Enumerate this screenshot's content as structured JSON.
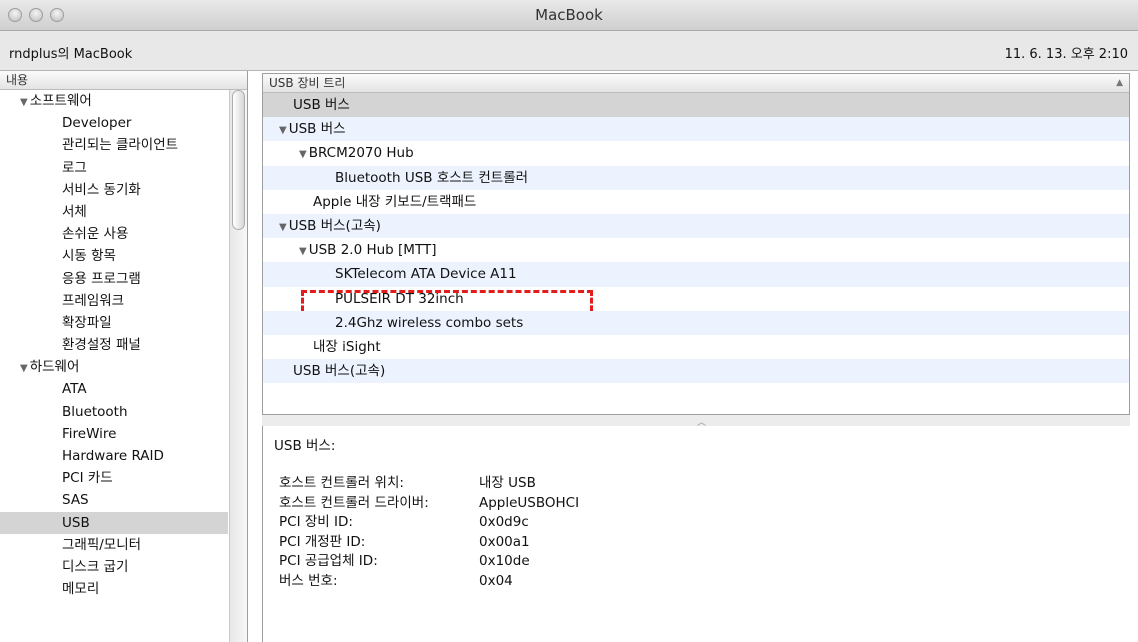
{
  "window": {
    "title": "MacBook"
  },
  "subheader": {
    "machine_name": "rndplus의 MacBook",
    "timestamp": "11. 6. 13. 오후 2:10"
  },
  "sidebar": {
    "header": "내용",
    "items": [
      {
        "label": "소프트웨어",
        "type": "category"
      },
      {
        "label": "Developer",
        "type": "sub"
      },
      {
        "label": "관리되는 클라이언트",
        "type": "sub"
      },
      {
        "label": "로그",
        "type": "sub"
      },
      {
        "label": "서비스 동기화",
        "type": "sub"
      },
      {
        "label": "서체",
        "type": "sub"
      },
      {
        "label": "손쉬운 사용",
        "type": "sub"
      },
      {
        "label": "시동 항목",
        "type": "sub"
      },
      {
        "label": "응용 프로그램",
        "type": "sub"
      },
      {
        "label": "프레임워크",
        "type": "sub"
      },
      {
        "label": "확장파일",
        "type": "sub"
      },
      {
        "label": "환경설정 패널",
        "type": "sub"
      },
      {
        "label": "하드웨어",
        "type": "category"
      },
      {
        "label": "ATA",
        "type": "sub"
      },
      {
        "label": "Bluetooth",
        "type": "sub"
      },
      {
        "label": "FireWire",
        "type": "sub"
      },
      {
        "label": "Hardware RAID",
        "type": "sub"
      },
      {
        "label": "PCI 카드",
        "type": "sub"
      },
      {
        "label": "SAS",
        "type": "sub"
      },
      {
        "label": "USB",
        "type": "sub",
        "selected": true
      },
      {
        "label": "그래픽/모니터",
        "type": "sub"
      },
      {
        "label": "디스크 굽기",
        "type": "sub"
      },
      {
        "label": "메모리",
        "type": "sub"
      }
    ]
  },
  "tree": {
    "header": "USB 장비 트리",
    "rows": [
      {
        "label": "USB 버스",
        "level": 0,
        "expanded": false,
        "selected": true
      },
      {
        "label": "USB 버스",
        "level": 0,
        "expanded": true
      },
      {
        "label": "BRCM2070 Hub",
        "level": 1,
        "expanded": true
      },
      {
        "label": "Bluetooth USB 호스트 컨트롤러",
        "level": 2
      },
      {
        "label": "Apple 내장 키보드/트랙패드",
        "level": 1
      },
      {
        "label": "USB 버스(고속)",
        "level": 0,
        "expanded": true
      },
      {
        "label": "USB 2.0 Hub [MTT]",
        "level": 1,
        "expanded": true
      },
      {
        "label": "SKTelecom ATA Device A11",
        "level": 2
      },
      {
        "label": "PULSEIR DT 32inch",
        "level": 2,
        "highlighted": true
      },
      {
        "label": "2.4Ghz wireless combo sets",
        "level": 2
      },
      {
        "label": "내장 iSight",
        "level": 1
      },
      {
        "label": "USB 버스(고속)",
        "level": 0
      }
    ]
  },
  "detail": {
    "title": "USB 버스:",
    "properties": [
      {
        "label": "호스트 컨트롤러 위치:",
        "value": "내장 USB"
      },
      {
        "label": "호스트 컨트롤러 드라이버:",
        "value": "AppleUSBOHCI"
      },
      {
        "label": "PCI 장비 ID:",
        "value": "0x0d9c"
      },
      {
        "label": "PCI 개정판 ID:",
        "value": "0x00a1"
      },
      {
        "label": "PCI 공급업체 ID:",
        "value": "0x10de"
      },
      {
        "label": "버스 번호:",
        "value": "0x04"
      }
    ]
  },
  "colors": {
    "highlight_border": "#e21b1b",
    "selection": "#d4d4d4",
    "alt_row": "#edf3fe"
  },
  "icons": {
    "disclosure_expanded": "▼",
    "sort_up": "▲",
    "splitter_grip": "︿"
  }
}
